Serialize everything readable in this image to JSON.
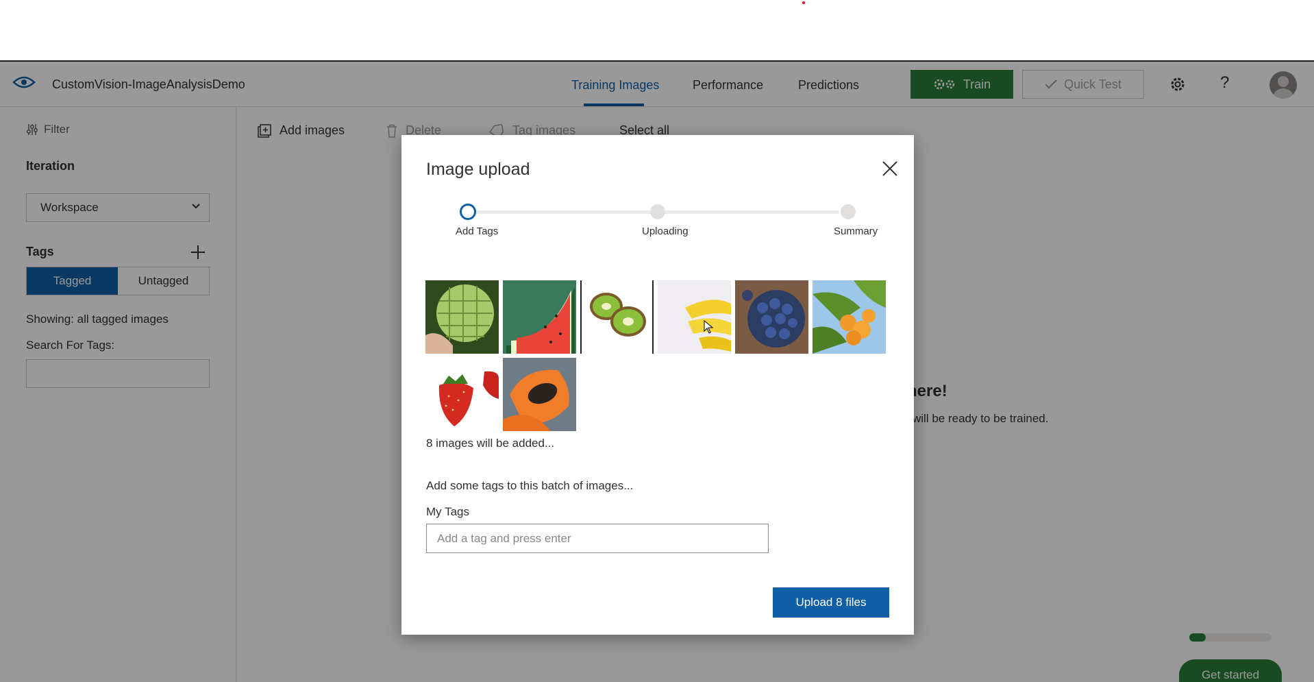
{
  "app": {
    "title": "CustomVision-ImageAnalysisDemo",
    "tabs": [
      {
        "label": "Training Images",
        "active": true
      },
      {
        "label": "Performance",
        "active": false
      },
      {
        "label": "Predictions",
        "active": false
      }
    ],
    "train_label": "Train",
    "quick_test_label": "Quick Test",
    "help_label": "?"
  },
  "sidebar": {
    "filter_label": "Filter",
    "iteration_heading": "Iteration",
    "iteration_value": "Workspace",
    "tags_heading": "Tags",
    "tagged_label": "Tagged",
    "untagged_label": "Untagged",
    "showing_text": "Showing: all tagged images",
    "search_label": "Search For Tags:",
    "search_value": ""
  },
  "toolbar": {
    "add_images": "Add images",
    "delete": "Delete",
    "tag_images": "Tag images",
    "select_all": "Select all"
  },
  "background": {
    "heading_fragment": "here!",
    "text_fragment": "will be ready to be trained.",
    "progress": 0.2,
    "get_started": "Get started"
  },
  "modal": {
    "title": "Image upload",
    "steps": [
      {
        "label": "Add Tags",
        "state": "current"
      },
      {
        "label": "Uploading",
        "state": "todo"
      },
      {
        "label": "Summary",
        "state": "todo"
      }
    ],
    "images": [
      {
        "name": "custard-apple"
      },
      {
        "name": "watermelon"
      },
      {
        "name": "kiwi"
      },
      {
        "name": "banana"
      },
      {
        "name": "blueberries"
      },
      {
        "name": "apricots"
      },
      {
        "name": "strawberries"
      },
      {
        "name": "papaya"
      }
    ],
    "count_text": "8 images will be added...",
    "batch_text": "Add some tags to this batch of images...",
    "my_tags_label": "My Tags",
    "tag_placeholder": "Add a tag and press enter",
    "upload_label": "Upload 8 files"
  },
  "colors": {
    "accent_blue": "#0f5fa6",
    "train_green": "#2a7d3b"
  }
}
